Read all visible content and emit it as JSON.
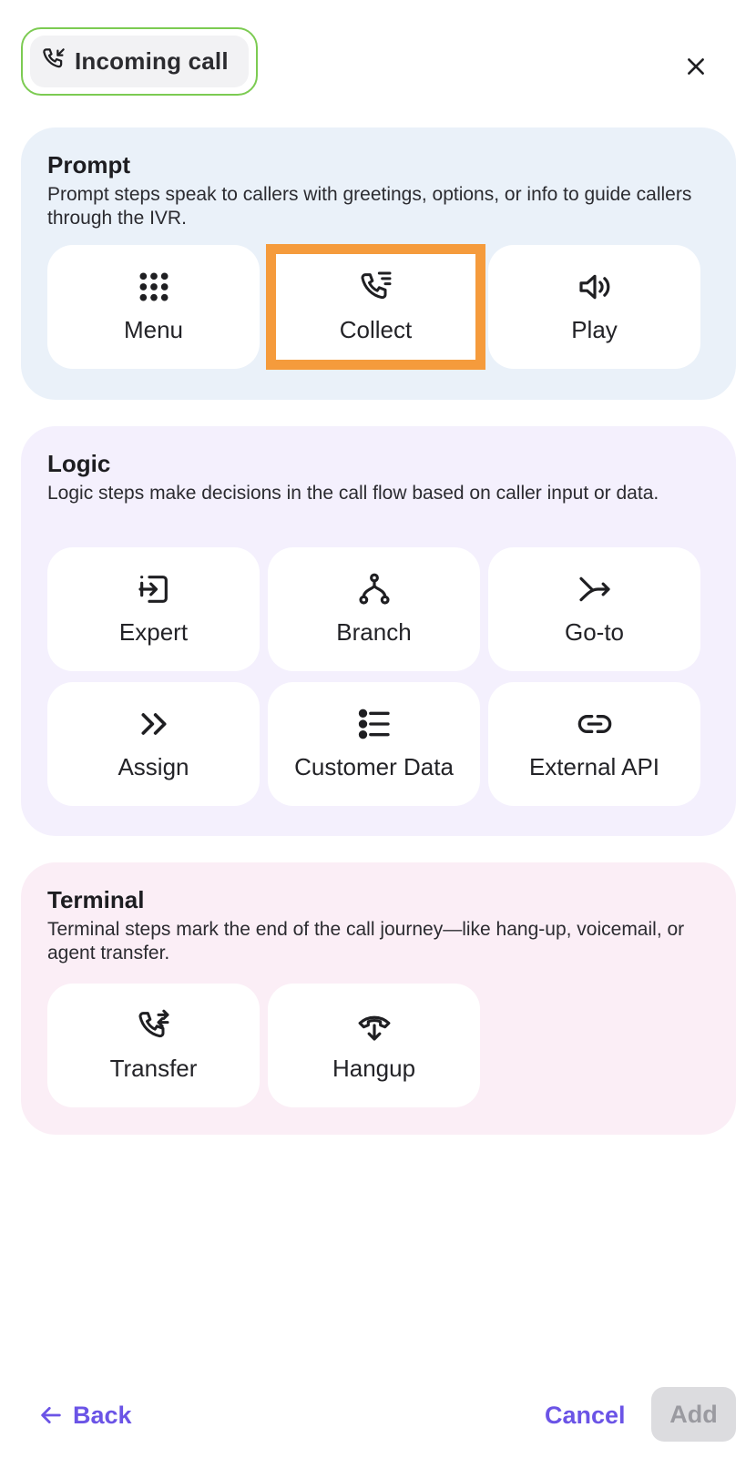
{
  "header": {
    "chip_label": "Incoming call",
    "chip_icon": "phone-incoming-icon",
    "close_icon": "close-icon",
    "chip_border_color": "#7ccb52"
  },
  "sections": {
    "prompt": {
      "title": "Prompt",
      "description": "Prompt steps speak to callers with greetings, options, or info to guide callers through the IVR.",
      "background": "#eaf1f9",
      "tiles": [
        {
          "label": "Menu",
          "icon": "grid-dots-icon",
          "selected": false
        },
        {
          "label": "Collect",
          "icon": "phone-list-icon",
          "selected": true
        },
        {
          "label": "Play",
          "icon": "speaker-icon",
          "selected": false
        }
      ]
    },
    "logic": {
      "title": "Logic",
      "description": "Logic steps make decisions in the call flow based on caller input or data.",
      "background": "#f4f0fd",
      "tiles": [
        {
          "label": "Expert",
          "icon": "sign-in-box-icon"
        },
        {
          "label": "Branch",
          "icon": "branch-icon"
        },
        {
          "label": "Go-to",
          "icon": "merge-arrow-icon"
        },
        {
          "label": "Assign",
          "icon": "double-chevron-right-icon"
        },
        {
          "label": "Customer Data",
          "icon": "list-icon"
        },
        {
          "label": "External API",
          "icon": "link-icon"
        }
      ]
    },
    "terminal": {
      "title": "Terminal",
      "description": "Terminal steps mark the end of the call journey—like hang-up, voicemail, or agent transfer.",
      "background": "#fbeef6",
      "tiles": [
        {
          "label": "Transfer",
          "icon": "phone-transfer-icon"
        },
        {
          "label": "Hangup",
          "icon": "phone-hangup-icon"
        }
      ]
    }
  },
  "footer": {
    "back_label": "Back",
    "cancel_label": "Cancel",
    "add_label": "Add",
    "accent_color": "#6b54e6",
    "selected_outline_color": "#f59b3c"
  }
}
